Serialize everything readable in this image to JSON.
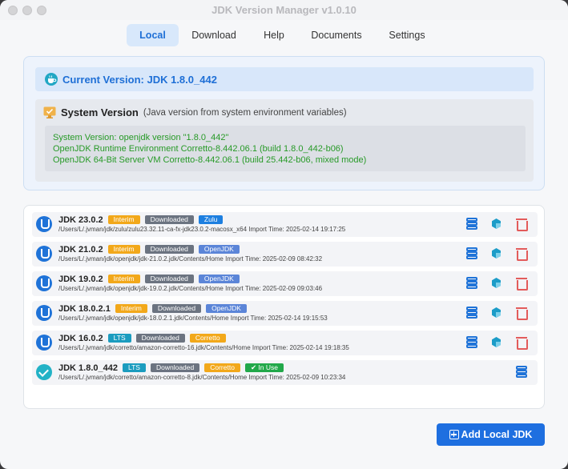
{
  "window": {
    "title": "JDK Version Manager v1.0.10"
  },
  "tabs": [
    {
      "label": "Local",
      "active": true
    },
    {
      "label": "Download",
      "active": false
    },
    {
      "label": "Help",
      "active": false
    },
    {
      "label": "Documents",
      "active": false
    },
    {
      "label": "Settings",
      "active": false
    }
  ],
  "current": {
    "label": "Current Version: JDK 1.8.0_442",
    "icon": "java-cup-icon"
  },
  "system": {
    "title": "System Version",
    "subtitle": "(Java version from system environment variables)",
    "icon": "monitor-check-icon",
    "output": [
      "System Version: openjdk version \"1.8.0_442\"",
      "OpenJDK Runtime Environment Corretto-8.442.06.1 (build 1.8.0_442-b06)",
      "OpenJDK 64-Bit Server VM Corretto-8.442.06.1 (build 25.442-b06, mixed mode)"
    ]
  },
  "jdks": [
    {
      "name": "JDK 23.0.2",
      "badges": [
        "Interim",
        "Downloaded",
        "Zulu"
      ],
      "path": "/Users/L/.jvman/jdk/zulu/zulu23.32.11-ca-fx-jdk23.0.2-macosx_x64 Import Time: 2025-02-14 19:17:25",
      "in_use": false
    },
    {
      "name": "JDK 21.0.2",
      "badges": [
        "Interim",
        "Downloaded",
        "OpenJDK"
      ],
      "path": "/Users/L/.jvman/jdk/openjdk/jdk-21.0.2.jdk/Contents/Home Import Time: 2025-02-09 08:42:32",
      "in_use": false
    },
    {
      "name": "JDK 19.0.2",
      "badges": [
        "Interim",
        "Downloaded",
        "OpenJDK"
      ],
      "path": "/Users/L/.jvman/jdk/openjdk/jdk-19.0.2.jdk/Contents/Home Import Time: 2025-02-09 09:03:46",
      "in_use": false
    },
    {
      "name": "JDK 18.0.2.1",
      "badges": [
        "Interim",
        "Downloaded",
        "OpenJDK"
      ],
      "path": "/Users/L/.jvman/jdk/openjdk/jdk-18.0.2.1.jdk/Contents/Home Import Time: 2025-02-14 19:15:53",
      "in_use": false
    },
    {
      "name": "JDK 16.0.2",
      "badges": [
        "LTS",
        "Downloaded",
        "Corretto"
      ],
      "path": "/Users/L/.jvman/jdk/corretto/amazon-corretto-16.jdk/Contents/Home Import Time: 2025-02-14 19:18:35",
      "in_use": false
    },
    {
      "name": "JDK 1.8.0_442",
      "badges": [
        "LTS",
        "Downloaded",
        "Corretto",
        "✔ In Use"
      ],
      "path": "/Users/L/.jvman/jdk/corretto/amazon-corretto-8.jdk/Contents/Home Import Time: 2025-02-09 10:23:34",
      "in_use": true
    }
  ],
  "actions": {
    "icons": [
      "layers-icon",
      "cube-icon",
      "trash-icon"
    ]
  },
  "add_button": {
    "label": "Add Local JDK",
    "icon": "add-square-icon"
  },
  "colors": {
    "accent": "#1e6fe0",
    "success_text": "#279a27",
    "danger": "#e35b5b"
  }
}
